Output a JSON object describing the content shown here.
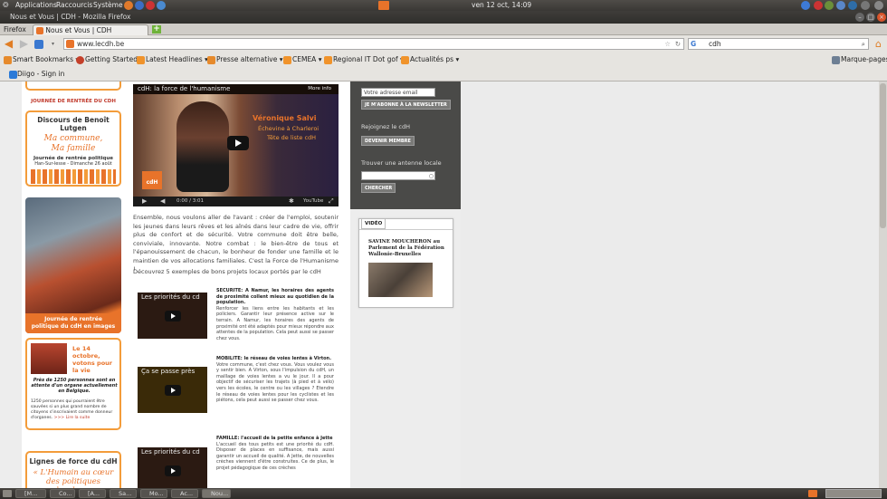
{
  "gnome_panel": {
    "menus": [
      "Applications",
      "Raccourcis",
      "Système"
    ],
    "clock": "ven 12 oct, 14:09"
  },
  "window": {
    "title": "Nous et Vous | CDH - Mozilla Firefox"
  },
  "browser": {
    "firefox_menu": "Firefox",
    "tab_title": "Nous et Vous | CDH",
    "url": "www.lecdh.be",
    "search_value": "cdh",
    "search_engine_letter": "G",
    "bookmarks": [
      "Smart Bookmarks",
      "Getting Started",
      "Latest Headlines",
      "Presse alternative",
      "CEMEA",
      "Regional IT Dot gof",
      "Actualités ps"
    ],
    "bookmarks_menu": "Marque-pages",
    "addon": "Diigo - Sign in"
  },
  "left_column": {
    "rentree_header": "JOURNÉE DE RENTRÉE DU CDH",
    "lutgen_title": "Discours de Benoît Lutgen",
    "lutgen_slogan": "Ma commune, Ma famille",
    "lutgen_sub": "Journée de rentrée politique",
    "lutgen_date": "Han-Sur-lesse - Dimanche 26 août",
    "images_caption": "Journée de rentrée politique du cdH en images",
    "vote_title": "Le 14 octobre, votons pour la vie",
    "vote_bold": "Près de 1250 personnes sont en attente d'un organe actuellement en Belgique.",
    "vote_text": "1250 personnes qui pourraient être sauvées si un plus grand nombre de citoyens s'inscrivaient comme donneur d'organes.",
    "vote_more": ">>> Lire la suite",
    "lignes_title": "Lignes de force du cdH",
    "lignes_slogan": "« L'Humain au cœur des politiques locales »"
  },
  "main": {
    "video_title": "cdH: la force de l'humanisme",
    "video_more": "More info",
    "video_overlay_name": "Véronique Salvi",
    "video_overlay_role1": "Échevine à Charleroi",
    "video_overlay_role2": "Tête de liste cdH",
    "video_time": "0:00 / 3:01",
    "intro": "Ensemble, nous voulons aller de l'avant : créer de l'emploi, soutenir les jeunes dans leurs rêves et les aînés dans leur cadre de vie, offrir plus de confort et de sécurité. Votre commune doit être belle, conviviale, innovante. Notre combat : le bien-être de tous et l'épanouissement de chacun, le bonheur de fonder une famille et le maintien de vos allocations familiales. C'est la Force de l'Humanisme !",
    "exemples": "Découvrez 5 exemples de bons projets locaux portés par le cdH",
    "articles": [
      {
        "video_title": "Les priorités du cd",
        "title": "SECURITE: A Namur, les horaires des agents de proximité collent mieux au quotidien de la population.",
        "text": "Renforcer les liens entre les habitants et les policiers. Garantir leur présence active sur le terrain. A Namur, les horaires des agents de proximité ont été adaptés pour mieux répondre aux attentes de la population. Cela peut aussi se passer chez vous."
      },
      {
        "video_title": "Ça se passe près",
        "title": "MOBILITE: le réseau de voies lentes à Virton.",
        "text": "Votre commune, c'est chez vous. Vous voulez vous y sentir bien. A Virton, sous l'impulsion du cdH, un maillage de voies lentes a vu le jour. Il a pour objectif de sécuriser les trajets (à pied et à vélo) vers les écoles, le centre ou les villages ? Etendre le réseau de voies lentes pour les cyclistes et les piétons, cela peut aussi se passer chez vous."
      },
      {
        "video_title": "Les priorités du cd",
        "title": "FAMILLE: l'accueil de la petite enfance à Jette",
        "text": "L'accueil des tous petits est une priorité du cdH. Disposer de places en suffisance, mais aussi garantir un accueil de qualité. A Jette, de nouvelles crèches viennent d'être construites. Ce de plus, le projet pédagogique de ces crèches"
      }
    ]
  },
  "sidebar": {
    "email_placeholder": "Votre adresse email",
    "newsletter_button": "JE M'ABONNE À LA NEWSLETTER",
    "join_label": "Rejoignez le cdH",
    "member_button": "DEVENIR MEMBRE",
    "antenne_label": "Trouver une antenne locale",
    "search_button": "CHERCHER",
    "video_tab": "VIDÉO",
    "video_caption": "SAVINE MOUCHERON au Parlement de la Fédération Wallonie-Bruxelles"
  },
  "taskbar": {
    "items": [
      "[M...",
      "Co...",
      "[A...",
      "Sa...",
      "Mo...",
      "Ac...",
      "Nou..."
    ]
  },
  "colors": {
    "brand_orange": "#f39c3a",
    "dark_panel": "#4a4a48",
    "red_title": "#c0392b"
  }
}
